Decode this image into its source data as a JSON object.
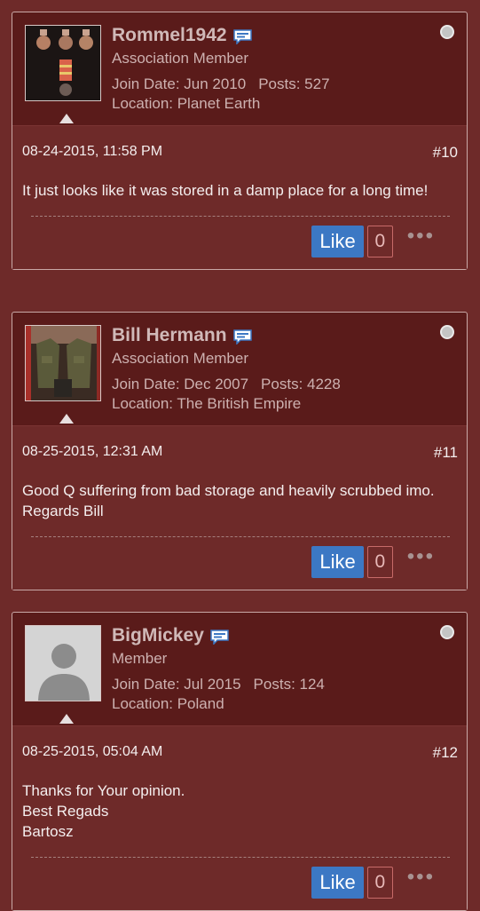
{
  "posts": [
    {
      "username": "Rommel1942",
      "rank": "Association Member",
      "join_date": "Join Date: Jun 2010",
      "posts": "Posts: 527",
      "location": "Location: Planet Earth",
      "timestamp": "08-24-2015, 11:58 PM",
      "post_number": "#10",
      "body": "It just looks like it was stored in a damp place for a long time!",
      "like_label": "Like",
      "like_count": "0",
      "more_label": "•••"
    },
    {
      "username": "Bill Hermann",
      "rank": "Association Member",
      "join_date": "Join Date: Dec 2007",
      "posts": "Posts: 4228",
      "location": "Location: The British Empire",
      "timestamp": "08-25-2015, 12:31 AM",
      "post_number": "#11",
      "body": "Good Q suffering from bad storage and heavily scrubbed imo. Regards Bill",
      "like_label": "Like",
      "like_count": "0",
      "more_label": "•••"
    },
    {
      "username": "BigMickey",
      "rank": "Member",
      "join_date": "Join Date: Jul 2015",
      "posts": "Posts: 124",
      "location": "Location: Poland",
      "timestamp": "08-25-2015, 05:04 AM",
      "post_number": "#12",
      "body_lines": [
        "Thanks for Your opinion.",
        "Best Regads",
        "Bartosz"
      ],
      "like_label": "Like",
      "like_count": "0",
      "more_label": "•••"
    }
  ],
  "colors": {
    "page_bg": "#6e2a29",
    "header_bg": "#5a1b1a",
    "like_button": "#3c78c4",
    "text": "#f4eeee",
    "muted_text": "#cdb1b0"
  },
  "icons": {
    "pm": "speech-bubble-icon",
    "status": "offline-status-icon",
    "more": "more-options-icon"
  }
}
